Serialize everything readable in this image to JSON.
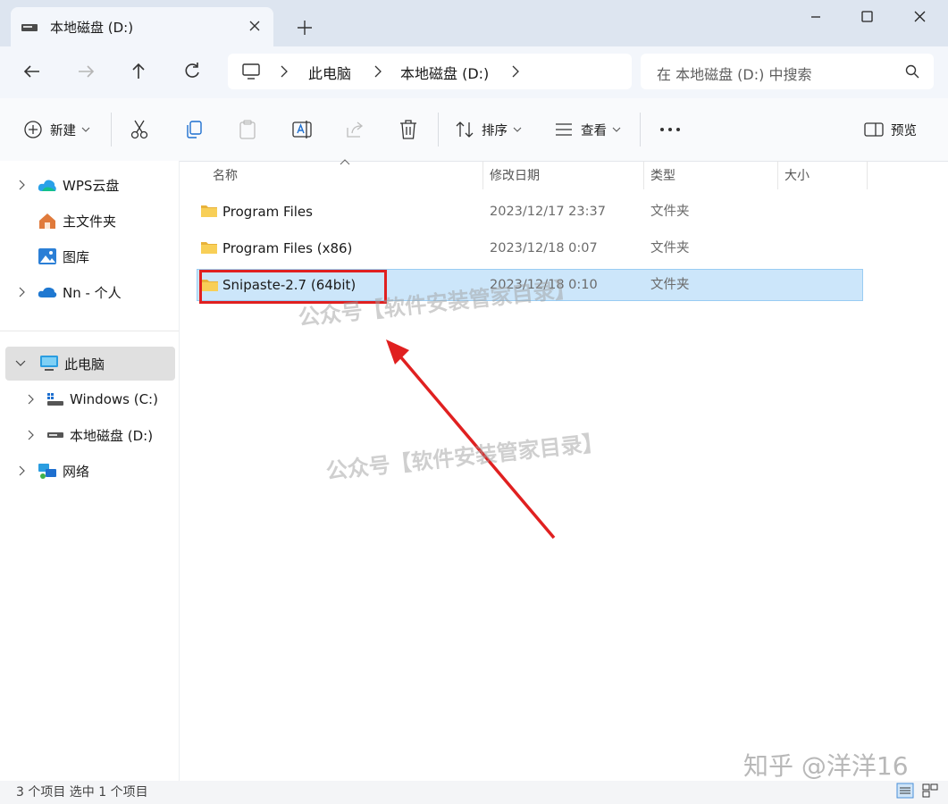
{
  "window": {
    "tab_title": "本地磁盘 (D:)",
    "controls": [
      "minimize-icon",
      "maximize-icon",
      "close-icon"
    ]
  },
  "breadcrumb": [
    "此电脑",
    "本地磁盘 (D:)"
  ],
  "search": {
    "placeholder": "在 本地磁盘 (D:) 中搜索"
  },
  "toolbar": {
    "new_label": "新建",
    "sort_label": "排序",
    "view_label": "查看",
    "preview_label": "预览",
    "icons": [
      "cut-icon",
      "copy-icon",
      "paste-icon",
      "rename-icon",
      "share-icon",
      "delete-icon",
      "more-icon"
    ]
  },
  "sidebar": {
    "items": [
      {
        "label": "WPS云盘",
        "icon": "wps-cloud-icon"
      },
      {
        "label": "主文件夹",
        "icon": "home-icon"
      },
      {
        "label": "图库",
        "icon": "gallery-icon"
      },
      {
        "label": "Nn - 个人",
        "icon": "onedrive-icon"
      },
      {
        "label": "此电脑",
        "icon": "this-pc-icon",
        "selected": true
      },
      {
        "label": "Windows (C:)",
        "icon": "drive-c-icon"
      },
      {
        "label": "本地磁盘 (D:)",
        "icon": "drive-d-icon"
      },
      {
        "label": "网络",
        "icon": "network-icon"
      }
    ]
  },
  "columns": {
    "name": "名称",
    "modified": "修改日期",
    "type": "类型",
    "size": "大小"
  },
  "files": [
    {
      "name": "Program Files",
      "modified": "2023/12/17 23:37",
      "type": "文件夹"
    },
    {
      "name": "Program Files (x86)",
      "modified": "2023/12/18 0:07",
      "type": "文件夹"
    },
    {
      "name": "Snipaste-2.7  (64bit)",
      "modified": "2023/12/18 0:10",
      "type": "文件夹",
      "selected": true
    }
  ],
  "status": {
    "text": "3 个项目    选中 1 个项目"
  },
  "annotations": {
    "watermark": "公众号【软件安装管家目录】",
    "brand": "知乎 @洋洋16",
    "highlight_color": "#e02020"
  }
}
